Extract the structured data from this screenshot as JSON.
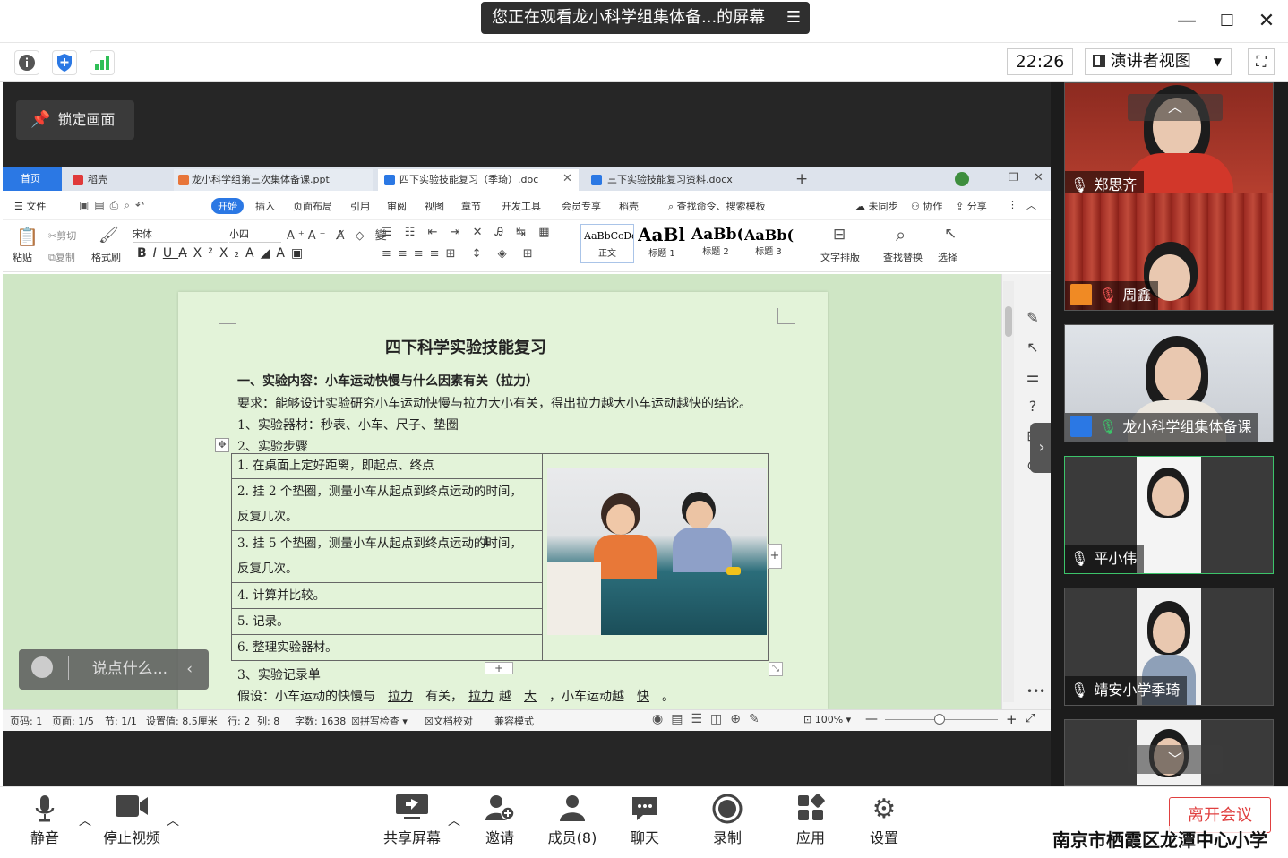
{
  "titlebar": {
    "share_banner": "您正在观看龙小科学组集体备...的屏幕",
    "minimize": "—",
    "maximize": "☐",
    "close": "✕"
  },
  "toolbar": {
    "info_icon": "info-icon",
    "security_icon": "shield-icon",
    "signal_icon": "signal-bars-icon",
    "clock": "22:26",
    "view_mode": "演讲者视图",
    "fullscreen_icon": "fullscreen-icon"
  },
  "stage": {
    "lock_screen": "锁定画面",
    "chat_placeholder": "说点什么..."
  },
  "wps": {
    "tabs": [
      {
        "label": "首页"
      },
      {
        "label": "稻壳"
      },
      {
        "label": "龙小科学组第三次集体备课.ppt"
      },
      {
        "label": "四下实验技能复习（季琦）.doc"
      },
      {
        "label": "三下实验技能复习资料.docx"
      }
    ],
    "menu": [
      "文件",
      "开始",
      "插入",
      "页面布局",
      "引用",
      "审阅",
      "视图",
      "章节",
      "开发工具",
      "会员专享",
      "稻壳",
      "查找命令、搜索模板",
      "未同步",
      "协作",
      "分享"
    ],
    "ribbon": {
      "paste": "粘贴",
      "cut": "剪切",
      "copy": "复制",
      "format_painter": "格式刷",
      "font": "宋体",
      "size": "小四",
      "styles": [
        {
          "preview": "AaBbCcDd",
          "label": "正文"
        },
        {
          "preview": "AaBl",
          "label": "标题 1"
        },
        {
          "preview": "AaBb(",
          "label": "标题 2"
        },
        {
          "preview": "AaBb(",
          "label": "标题 3"
        }
      ],
      "text_layout": "文字排版",
      "find_replace": "查找替换",
      "select": "选择"
    },
    "document": {
      "title": "四下科学实验技能复习",
      "heading1": "一、实验内容：小车运动快慢与什么因素有关（拉力）",
      "requirement": "要求：能够设计实验研究小车运动快慢与拉力大小有关，得出拉力越大小车运动越快的结论。",
      "materials": "1、实验器材：秒表、小车、尺子、垫圈",
      "steps_title": "2、实验步骤",
      "steps": [
        "1. 在桌面上定好距离，即起点、终点",
        "2. 挂 2 个垫圈，测量小车从起点到终点运动的时间，",
        "反复几次。",
        "3. 挂 5 个垫圈，测量小车从起点到终点运动的时间，",
        "反复几次。",
        "4. 计算并比较。",
        "5. 记录。",
        "6. 整理实验器材。"
      ],
      "record_title": "3、实验记录单",
      "hypothesis_prefix": "假设：小车运动的快慢与",
      "blank1": "拉力",
      "hyp_mid1": "有关，",
      "blank2": "拉力",
      "hyp_mid2": "越",
      "blank3": "大",
      "hyp_mid3": "，小车运动越",
      "blank4": "快",
      "hyp_end": "。"
    },
    "status": {
      "page_no": "页码: 1",
      "pages": "页面: 1/5",
      "section": "节: 1/1",
      "setting": "设置值: 8.5厘米",
      "row": "行: 2",
      "col": "列: 8",
      "words": "字数: 1638",
      "spell": "拼写检查",
      "proof": "文档校对",
      "compat": "兼容模式",
      "zoom": "100%"
    }
  },
  "participants": [
    {
      "name": "郑思齐",
      "mic": "on"
    },
    {
      "name": "周鑫",
      "mic": "muted"
    },
    {
      "name": "龙小科学组集体备课",
      "mic": "on"
    },
    {
      "name": "平小伟",
      "mic": "on"
    },
    {
      "name": "靖安小学季琦",
      "mic": "on"
    },
    {
      "name": ""
    }
  ],
  "bottom": {
    "mute": "静音",
    "stop_video": "停止视频",
    "share_screen": "共享屏幕",
    "invite": "邀请",
    "members": "成员(8)",
    "chat": "聊天",
    "record": "录制",
    "apps": "应用",
    "settings": "设置",
    "leave": "离开会议",
    "school_name": "南京市栖霞区龙潭中心小学"
  },
  "colors": {
    "doc_bg": "#cfe6c5",
    "page_bg": "#e3f3d9",
    "accent_blue": "#2b78e4",
    "leave_red": "#e04040",
    "mic_green": "#3cc46a"
  }
}
